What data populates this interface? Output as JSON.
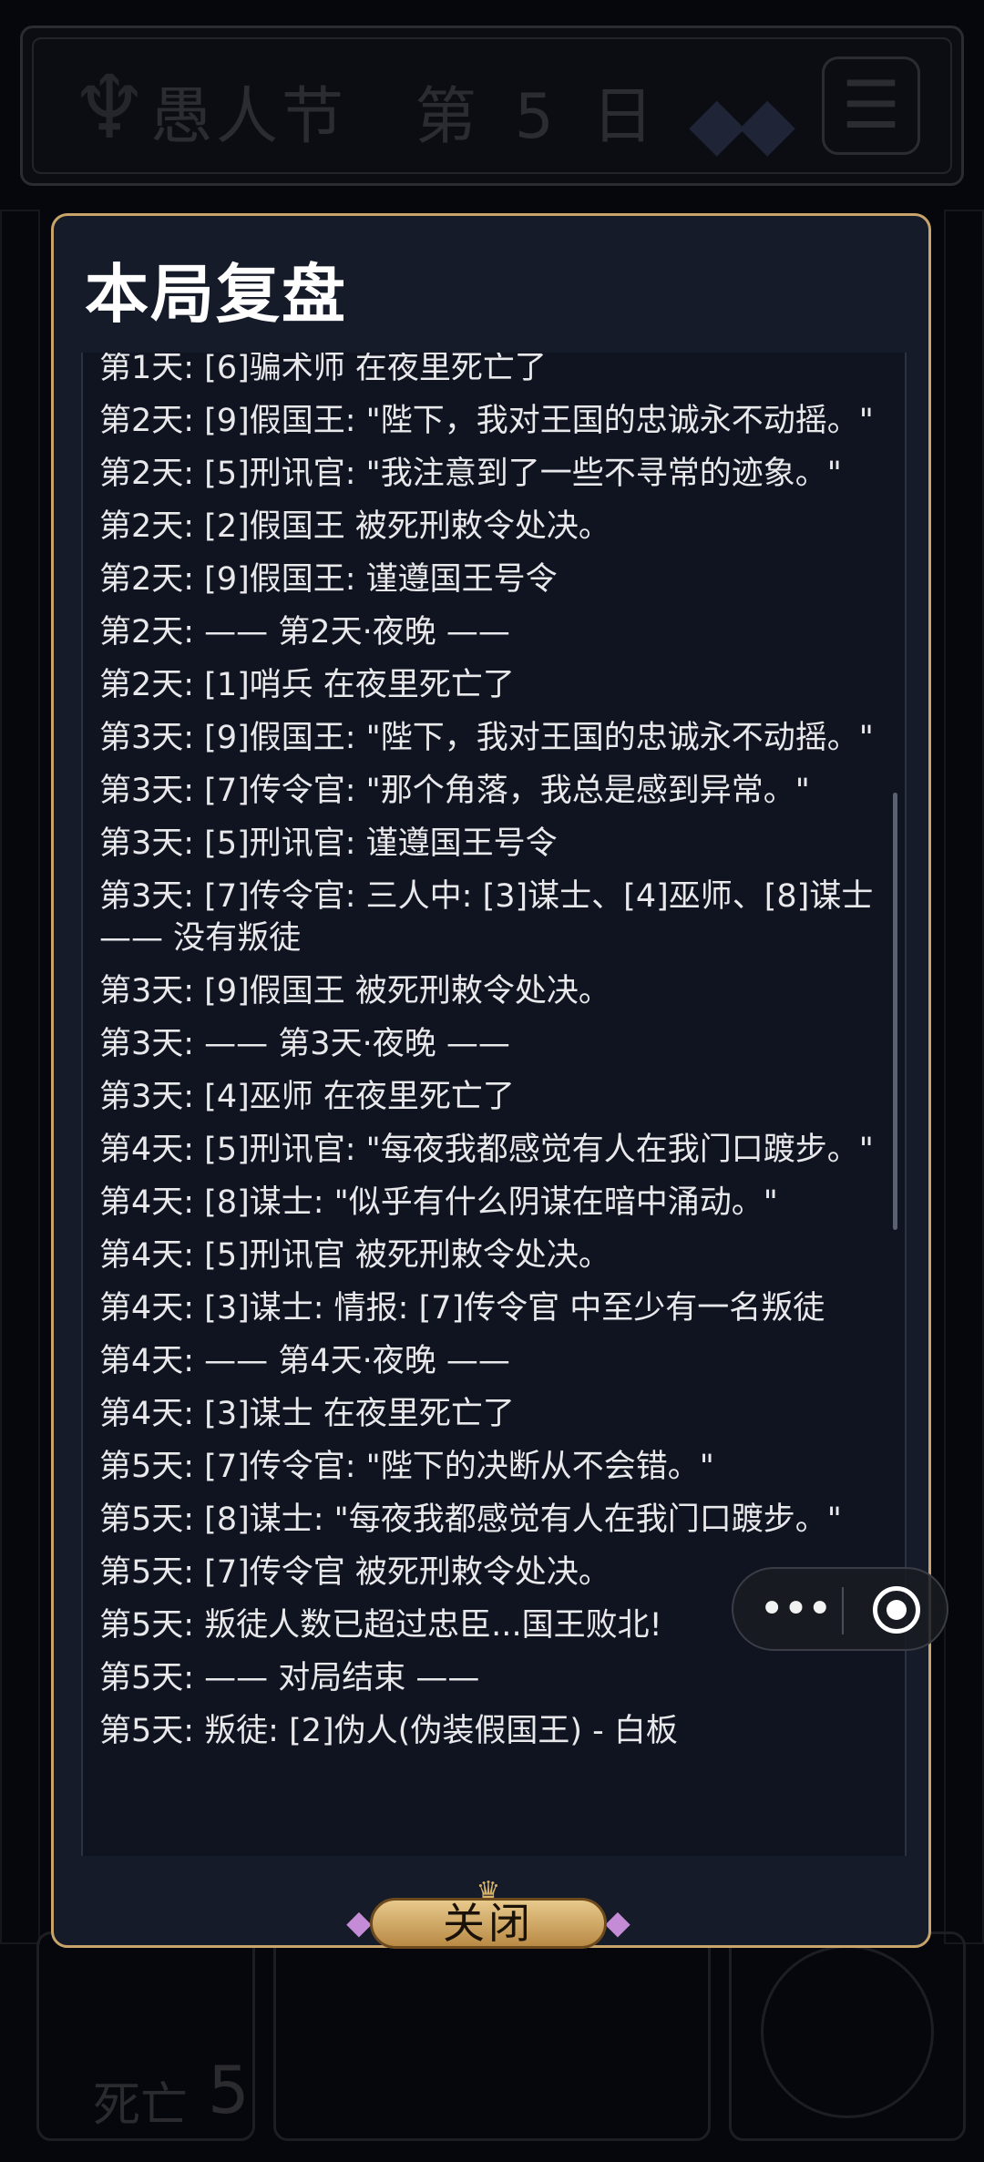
{
  "background": {
    "title": "愚人节",
    "day": "第 5 日",
    "menu_icon": "☰",
    "crest_icon": "♆",
    "gems_icon": "◆◆",
    "dead_label": "死亡",
    "dead_count": "5"
  },
  "modal": {
    "title": "本局复盘",
    "close_label": "关闭",
    "log": [
      "第1天: [6]骗术师 在夜里死亡了",
      "第2天: [9]假国王: \"陛下，我对王国的忠诚永不动摇。\"",
      "第2天: [5]刑讯官: \"我注意到了一些不寻常的迹象。\"",
      "第2天: [2]假国王 被死刑敕令处决。",
      "第2天: [9]假国王: 谨遵国王号令",
      "第2天: —— 第2天·夜晚 ——",
      "第2天: [1]哨兵 在夜里死亡了",
      "第3天: [9]假国王: \"陛下，我对王国的忠诚永不动摇。\"",
      "第3天: [7]传令官: \"那个角落，我总是感到异常。\"",
      "第3天: [5]刑讯官: 谨遵国王号令",
      "第3天: [7]传令官: 三人中: [3]谋士、[4]巫师、[8]谋士 —— 没有叛徒",
      "第3天: [9]假国王 被死刑敕令处决。",
      "第3天: —— 第3天·夜晚 ——",
      "第3天: [4]巫师 在夜里死亡了",
      "第4天: [5]刑讯官: \"每夜我都感觉有人在我门口踱步。\"",
      "第4天: [8]谋士: \"似乎有什么阴谋在暗中涌动。\"",
      "第4天: [5]刑讯官 被死刑敕令处决。",
      "第4天: [3]谋士: 情报: [7]传令官 中至少有一名叛徒",
      "第4天: —— 第4天·夜晚 ——",
      "第4天: [3]谋士 在夜里死亡了",
      "第5天: [7]传令官: \"陛下的决断从不会错。\"",
      "第5天: [8]谋士: \"每夜我都感觉有人在我门口踱步。\"",
      "第5天: [7]传令官 被死刑敕令处决。",
      "第5天: 叛徒人数已超过忠臣...国王败北!",
      "第5天: —— 对局结束 ——",
      "第5天:    叛徒: [2]伪人(伪装假国王) - 白板"
    ]
  },
  "capsule": {
    "more_icon": "•••",
    "target_icon": "◉"
  }
}
